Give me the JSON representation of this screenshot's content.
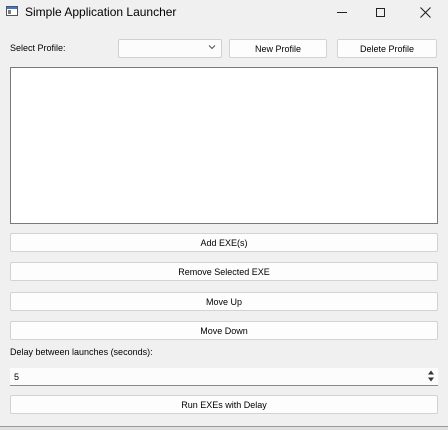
{
  "window": {
    "title": "Simple Application Launcher"
  },
  "icons": {
    "app": "app-window-icon",
    "minimize": "minimize-icon",
    "maximize": "maximize-icon",
    "close": "close-icon",
    "dropdown": "chevron-down-icon",
    "spin_up": "spin-up-icon",
    "spin_down": "spin-down-icon"
  },
  "profile": {
    "label": "Select Profile:",
    "selected": "",
    "new_label": "New Profile",
    "delete_label": "Delete Profile"
  },
  "exe_list": {
    "items": []
  },
  "buttons": {
    "add": "Add EXE(s)",
    "remove": "Remove Selected EXE",
    "move_up": "Move Up",
    "move_down": "Move Down",
    "run": "Run EXEs with Delay"
  },
  "delay": {
    "label": "Delay between launches (seconds):",
    "value": "5"
  },
  "close_glyph": "✕"
}
